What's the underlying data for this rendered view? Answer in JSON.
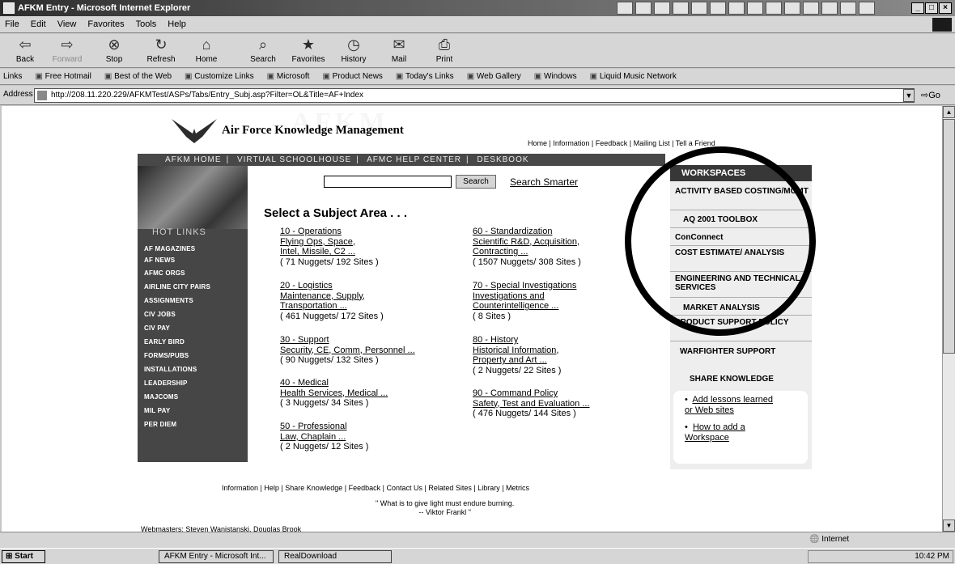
{
  "window": {
    "title": "AFKM Entry - Microsoft Internet Explorer",
    "buttons": [
      "_",
      "□",
      "×"
    ]
  },
  "menu": [
    "File",
    "Edit",
    "View",
    "Favorites",
    "Tools",
    "Help"
  ],
  "toolbar": [
    {
      "label": "Back",
      "icon": "⇦",
      "disabled": false
    },
    {
      "label": "Forward",
      "icon": "⇨",
      "disabled": true
    },
    {
      "label": "Stop",
      "icon": "⊗",
      "disabled": false
    },
    {
      "label": "Refresh",
      "icon": "↻",
      "disabled": false
    },
    {
      "label": "Home",
      "icon": "⌂",
      "disabled": false
    },
    {
      "label": "Search",
      "icon": "⌕",
      "disabled": false
    },
    {
      "label": "Favorites",
      "icon": "★",
      "disabled": false
    },
    {
      "label": "History",
      "icon": "◷",
      "disabled": false
    },
    {
      "label": "Mail",
      "icon": "✉",
      "disabled": false
    },
    {
      "label": "Print",
      "icon": "⎙",
      "disabled": false
    }
  ],
  "links": {
    "label": "Links",
    "items": [
      "Free Hotmail",
      "Best of the Web",
      "Customize Links",
      "Microsoft",
      "Product News",
      "Today's Links",
      "Web Gallery",
      "Windows",
      "Liquid Music Network"
    ]
  },
  "address": {
    "label": "Address",
    "url": "http://208.11.220.229/AFKMTest/ASPs/Tabs/Entry_Subj.asp?Filter=OL&Title=AF+Index",
    "go": "Go"
  },
  "page": {
    "site_title": "Air Force Knowledge Management",
    "watermark": "AFKM",
    "top_links": "Home | Information | Feedback | Mailing List | Tell a Friend",
    "nav": [
      "AFKM HOME",
      "VIRTUAL SCHOOLHOUSE",
      "AFMC HELP CENTER",
      "DESKBOOK"
    ],
    "search_button": "Search",
    "search_smarter": "Search Smarter",
    "subject_title": "Select a Subject Area . . .",
    "hot_links_title": "HOT LINKS",
    "hot_links": [
      "AF MAGAZINES",
      "AF NEWS",
      "AFMC ORGS",
      "AIRLINE CITY PAIRS",
      "ASSIGNMENTS",
      "CIV JOBS",
      "CIV PAY",
      "EARLY BIRD",
      "FORMS/PUBS",
      "INSTALLATIONS",
      "LEADERSHIP",
      "MAJCOMS",
      "MIL PAY",
      "PER DIEM"
    ],
    "subjects_left": [
      {
        "title": "10 - Operations",
        "desc": [
          "Flying Ops, Space,",
          "Intel, Missile, C2 ..."
        ],
        "count": "( 71 Nuggets/ 192 Sites )"
      },
      {
        "title": "20 - Logistics",
        "desc": [
          "Maintenance, Supply,",
          "Transportation ..."
        ],
        "count": "( 461 Nuggets/ 172 Sites )"
      },
      {
        "title": "30 - Support",
        "desc": [
          "Security, CE, Comm, Personnel ..."
        ],
        "count": "( 90 Nuggets/ 132 Sites )"
      },
      {
        "title": "40 - Medical",
        "desc": [
          "Health Services, Medical ..."
        ],
        "count": "( 3 Nuggets/ 34 Sites )"
      },
      {
        "title": "50 - Professional",
        "desc": [
          "Law, Chaplain ..."
        ],
        "count": "( 2 Nuggets/ 12 Sites )"
      }
    ],
    "subjects_right": [
      {
        "title": "60 - Standardization",
        "desc": [
          "Scientific R&D, Acquisition,",
          "Contracting ..."
        ],
        "count": "( 1507 Nuggets/ 308 Sites )"
      },
      {
        "title": "70 - Special Investigations",
        "desc": [
          "Investigations and",
          "Counterintelligence ..."
        ],
        "count": "( 8 Sites )"
      },
      {
        "title": "80 - History",
        "desc": [
          "Historical Information,",
          "Property and Art ..."
        ],
        "count": "( 2 Nuggets/ 22 Sites )"
      },
      {
        "title": "90 - Command Policy",
        "desc": [
          "Safety, Test and Evaluation ..."
        ],
        "count": "( 476 Nuggets/ 144 Sites )"
      }
    ],
    "workspaces_title": "WORKSPACES",
    "workspaces": [
      "ACTIVITY BASED COSTING/MGMT",
      "AQ 2001 TOOLBOX",
      "ConConnect",
      "COST ESTIMATE/ ANALYSIS",
      "ENGINEERING AND TECHNICAL SERVICES",
      "MARKET ANALYSIS",
      "PRODUCT SUPPORT POLICY",
      "WARFIGHTER SUPPORT"
    ],
    "share_title": "SHARE KNOWLEDGE",
    "share_links": [
      {
        "lines": [
          "Add lessons learned",
          "or Web sites"
        ]
      },
      {
        "lines": [
          "How to add a",
          "Workspace"
        ]
      }
    ],
    "bottom_links": "Information  |  Help  |  Share Knowledge  |  Feedback  |  Contact Us  |  Related Sites  |  Library  |  Metrics",
    "quote": "\" What is to give light must endure burning.",
    "quote_author": "-- Viktor Frankl \"",
    "webmasters": "Webmasters: Steven Wanistanski, Douglas Brook"
  },
  "status": {
    "zone": "Internet"
  },
  "taskbar": {
    "start": "Start",
    "tasks": [
      "AFKM Entry - Microsoft Int...",
      "RealDownload"
    ],
    "clock": "10:42 PM"
  }
}
